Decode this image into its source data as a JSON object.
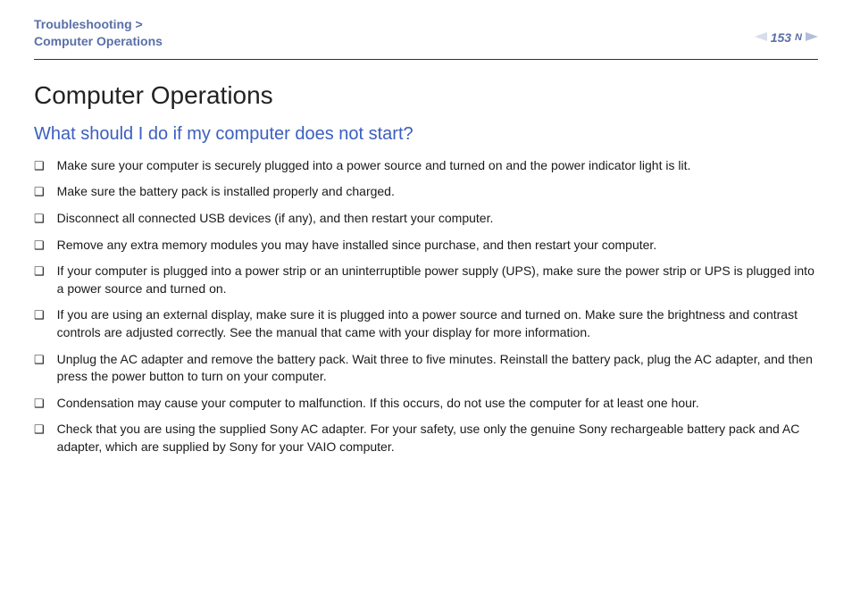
{
  "header": {
    "breadcrumb_line1": "Troubleshooting >",
    "breadcrumb_line2": "Computer Operations",
    "page_number": "153",
    "n_marker": "N"
  },
  "main": {
    "title": "Computer Operations",
    "question": "What should I do if my computer does not start?",
    "bullets": [
      "Make sure your computer is securely plugged into a power source and turned on and the power indicator light is lit.",
      "Make sure the battery pack is installed properly and charged.",
      "Disconnect all connected USB devices (if any), and then restart your computer.",
      "Remove any extra memory modules you may have installed since purchase, and then restart your computer.",
      "If your computer is plugged into a power strip or an uninterruptible power supply (UPS), make sure the power strip or UPS is plugged into a power source and turned on.",
      "If you are using an external display, make sure it is plugged into a power source and turned on. Make sure the brightness and contrast controls are adjusted correctly. See the manual that came with your display for more information.",
      "Unplug the AC adapter and remove the battery pack. Wait three to five minutes. Reinstall the battery pack, plug the AC adapter, and then press the power button to turn on your computer.",
      "Condensation may cause your computer to malfunction. If this occurs, do not use the computer for at least one hour.",
      "Check that you are using the supplied Sony AC adapter. For your safety, use only the genuine Sony rechargeable battery pack and AC adapter, which are supplied by Sony for your VAIO computer."
    ]
  }
}
